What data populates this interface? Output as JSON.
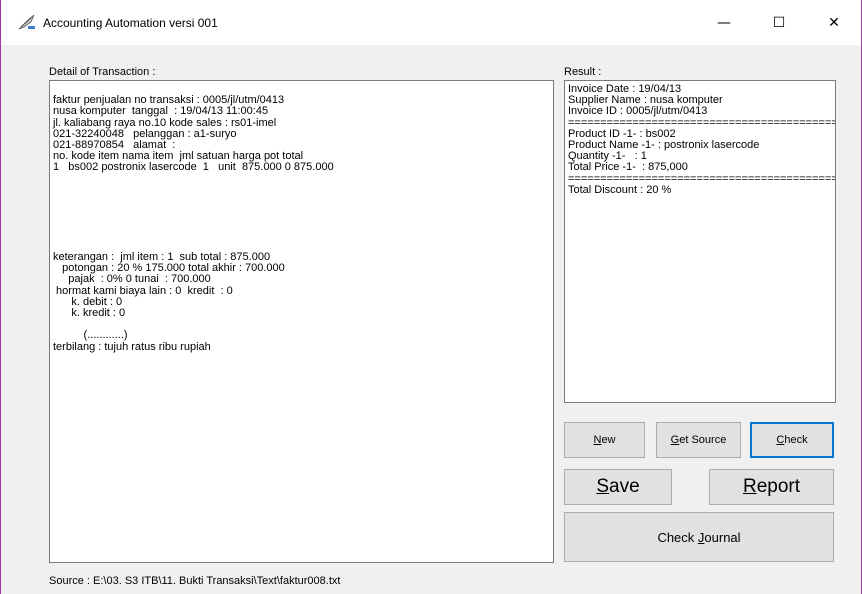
{
  "window": {
    "title": "Accounting Automation versi 001",
    "minimize_glyph": "—",
    "maximize_glyph": "☐",
    "close_glyph": "✕"
  },
  "detail": {
    "label": "Detail of Transaction :",
    "content": "\nfaktur penjualan no transaksi : 0005/jl/utm/0413\nnusa komputer  tanggal  : 19/04/13 11:00:45\njl. kaliabang raya no.10 kode sales : rs01-imel\n021-32240048   pelanggan : a1-suryo\n021-88970854   alamat  :\nno. kode item nama item  jml satuan harga pot total\n1   bs002 postronix lasercode  1   unit  875.000 0 875.000\n\n\n\n\n\n\n\nketerangan :  jml item : 1  sub total : 875.000\n   potongan : 20 % 175.000 total akhir : 700.000\n     pajak  : 0% 0 tunai  : 700.000\n hormat kami biaya lain : 0  kredit  : 0\n      k. debit : 0\n      k. kredit : 0\n\n          (............)\nterbilang : tujuh ratus ribu rupiah"
  },
  "result": {
    "label": "Result :",
    "content": "Invoice Date : 19/04/13\nSupplier Name : nusa komputer\nInvoice ID : 0005/jl/utm/0413\n============================================\nProduct ID -1- : bs002\nProduct Name -1- : postronix lasercode\nQuantity -1-   : 1\nTotal Price -1-  : 875,000\n============================================\nTotal Discount : 20 %"
  },
  "buttons": {
    "new": {
      "mnemonic": "N",
      "rest": "ew"
    },
    "get_source": {
      "mnemonic": "G",
      "rest": "et Source"
    },
    "check": {
      "mnemonic": "C",
      "rest": "heck"
    },
    "save": {
      "mnemonic": "S",
      "rest": "ave"
    },
    "report": {
      "mnemonic": "R",
      "rest": "eport"
    },
    "check_journal": {
      "before": "Check ",
      "mnemonic": "J",
      "rest": "ournal"
    }
  },
  "source": {
    "text": "Source : E:\\03. S3 ITB\\11. Bukti Transaksi\\Text\\faktur008.txt"
  },
  "colors": {
    "window_border": "#9e3aa5",
    "focus_border": "#0078d7",
    "button_bg": "#e1e1e1",
    "form_bg": "#f0f0f0"
  },
  "icons": {
    "app": "quill-pen-icon"
  }
}
